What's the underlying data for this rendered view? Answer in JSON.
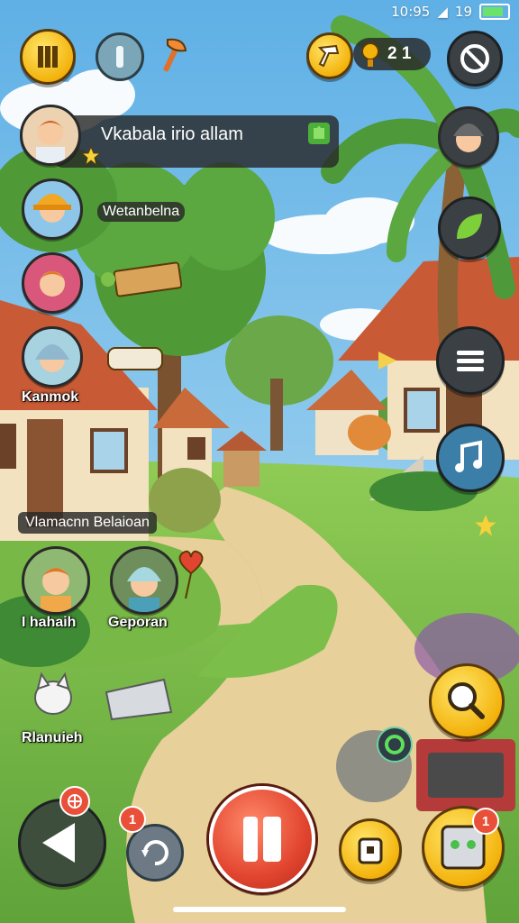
{
  "status_bar": {
    "time": "10:95",
    "battery_label": "19"
  },
  "hud": {
    "coin_count": "2 1"
  },
  "quest_banner": {
    "title": "Vkabala irio allam"
  },
  "villagers": {
    "v2_name": "Wetanbelna",
    "v4_name": "Kanmok",
    "group_header": "Vlamacnn Belaioan",
    "v5_name": "I hahaih",
    "v6_name": "Geporan",
    "pet_name": "Rlanuieh"
  },
  "badges": {
    "refresh_count": "1",
    "gift_count": "1"
  },
  "colors": {
    "sky": "#7fc4ec",
    "grass": "#7bbf4a",
    "path": "#e8d09a",
    "roof": "#c85a35",
    "accent_yellow": "#f3b30c",
    "record_red": "#e2452f"
  }
}
